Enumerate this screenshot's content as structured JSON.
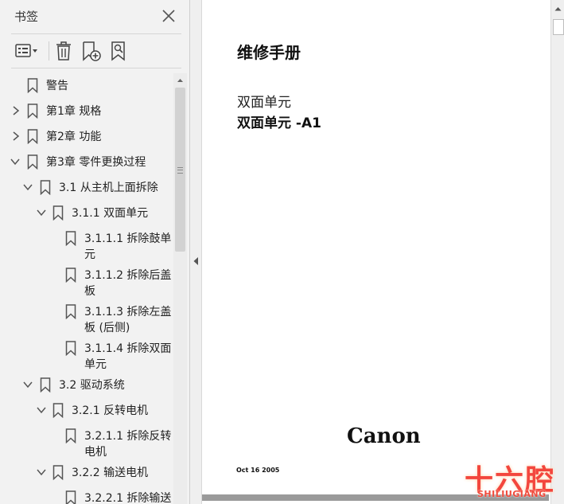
{
  "panel": {
    "title": "书签",
    "close_icon": "close-icon",
    "toolbar": {
      "options_icon": "list-options-icon",
      "delete_icon": "trash-icon",
      "new_bookmark_icon": "bookmark-add-icon",
      "find_bookmark_icon": "bookmark-search-icon"
    }
  },
  "bookmarks": [
    {
      "label": "警告"
    },
    {
      "label": "第1章 规格"
    },
    {
      "label": "第2章 功能"
    },
    {
      "label": "第3章 零件更换过程"
    },
    {
      "label": "3.1 从主机上面拆除"
    },
    {
      "label": "3.1.1 双面单元"
    },
    {
      "label": "3.1.1.1 拆除鼓单元"
    },
    {
      "label": "3.1.1.2 拆除后盖板"
    },
    {
      "label": "3.1.1.3 拆除左盖板 (后侧)"
    },
    {
      "label": "3.1.1.4 拆除双面单元"
    },
    {
      "label": "3.2 驱动系统"
    },
    {
      "label": "3.2.1 反转电机"
    },
    {
      "label": "3.2.1.1 拆除反转电机"
    },
    {
      "label": "3.2.2 输送电机"
    },
    {
      "label": "3.2.2.1 拆除输送"
    }
  ],
  "document": {
    "title": "维修手册",
    "subtitle": "双面单元",
    "subtitle_bold": "双面单元 -A1",
    "brand": "Canon",
    "date": "Oct 16 2005"
  },
  "watermark": {
    "text": "十六腔",
    "subtext": "SHILIUGIANG"
  },
  "colors": {
    "panel_bg": "#f2f2f2",
    "watermark": "#f3463d"
  }
}
